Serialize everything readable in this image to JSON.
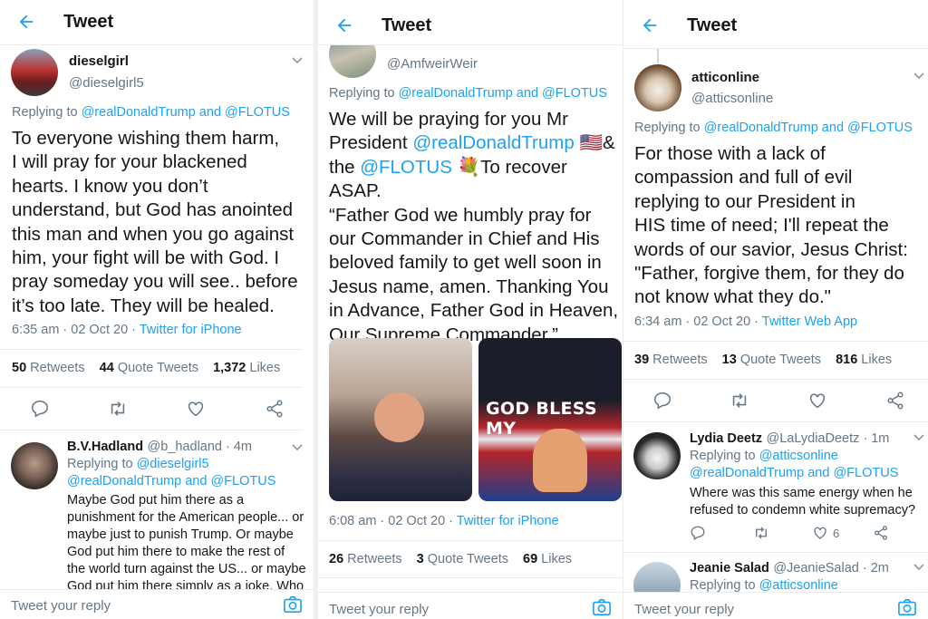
{
  "header": {
    "title": "Tweet"
  },
  "composer": {
    "placeholder": "Tweet your reply"
  },
  "panel1": {
    "author": {
      "name": "dieselgirl",
      "handle": "@dieselgirl5"
    },
    "replying_prefix": "Replying to ",
    "replying_to": "@realDonaldTrump and @FLOTUS",
    "text": [
      "To everyone wishing them harm,",
      "I will pray for your blackened",
      "hearts. I know you don’t",
      "understand, but God has anointed",
      "this man and when you go against",
      "him, your fight will be with God.  I",
      "pray someday you will see.. before",
      "it’s too late.  They will be healed."
    ],
    "meta": "6:35 am · 02 Oct 20 · ",
    "source": "Twitter for iPhone",
    "stats": {
      "retweets": "50",
      "retweets_label": "Retweets",
      "quotes": "44",
      "quotes_label": "Quote Tweets",
      "likes": "1,372",
      "likes_label": "Likes"
    },
    "reply": {
      "name": "B.V.Hadland",
      "handle": "@b_hadland · 4m",
      "replying_prefix": "Replying to ",
      "replying_to_1": "@dieselgirl5",
      "replying_to_2": "@realDonaldTrump and @FLOTUS",
      "text": [
        "Maybe God put him there as a",
        "punishment for the American people... or",
        "maybe just to punish Trump. Or maybe",
        "God put him there to make the rest of",
        "the world turn against the US... or maybe",
        "God put him there simply as a joke. Who"
      ]
    }
  },
  "panel2": {
    "author": {
      "handle": "@AmfweirWeir"
    },
    "replying_prefix": "Replying to ",
    "replying_to": "@realDonaldTrump and @FLOTUS",
    "text_l1": "We will be praying for you Mr",
    "text_l2a": "President ",
    "text_l2b": "@realDonaldTrump",
    "text_l2c": " 🇺🇸&",
    "text_l3a": "the ",
    "text_l3b": "@FLOTUS",
    "text_l3c": " 💐To recover ASAP.",
    "text_rest": [
      "“Father God we humbly pray for",
      "our Commander in Chief and His",
      "beloved family to get well soon in",
      "Jesus name, amen. Thanking You",
      "in Advance, Father God in Heaven,",
      "Our Supreme Commander.”"
    ],
    "image_caption": "GOD BLESS MY",
    "meta": "6:08 am · 02 Oct 20 · ",
    "source": "Twitter for iPhone",
    "stats": {
      "retweets": "26",
      "retweets_label": "Retweets",
      "quotes": "3",
      "quotes_label": "Quote Tweets",
      "likes": "69",
      "likes_label": "Likes"
    }
  },
  "panel3": {
    "author": {
      "name": "atticonline",
      "handle": "@atticsonline"
    },
    "replying_prefix": "Replying to ",
    "replying_to": "@realDonaldTrump and @FLOTUS",
    "text": [
      "For those with a lack of",
      "compassion and full of evil",
      "replying to our President in",
      "HIS time of need; I'll repeat the",
      "words of our savior, Jesus Christ:",
      "\"Father, forgive them, for they do",
      "not know what they do.\""
    ],
    "meta": "6:34 am · 02 Oct 20 · ",
    "source": "Twitter Web App",
    "stats": {
      "retweets": "39",
      "retweets_label": "Retweets",
      "quotes": "13",
      "quotes_label": "Quote Tweets",
      "likes": "816",
      "likes_label": "Likes"
    },
    "reply1": {
      "name": "Lydia Deetz",
      "handle": "@LaLydiaDeetz · 1m",
      "replying_prefix": "Replying to ",
      "replying_to_1": "@atticsonline",
      "replying_to_2": "@realDonaldTrump and @FLOTUS",
      "text": [
        "Where was this same energy when he",
        "refused to condemn white supremacy?"
      ],
      "like_count": "6"
    },
    "reply2": {
      "name": "Jeanie Salad",
      "handle": "@JeanieSalad · 2m",
      "replying_prefix": "Replying to ",
      "replying_to_1": "@atticsonline"
    }
  }
}
